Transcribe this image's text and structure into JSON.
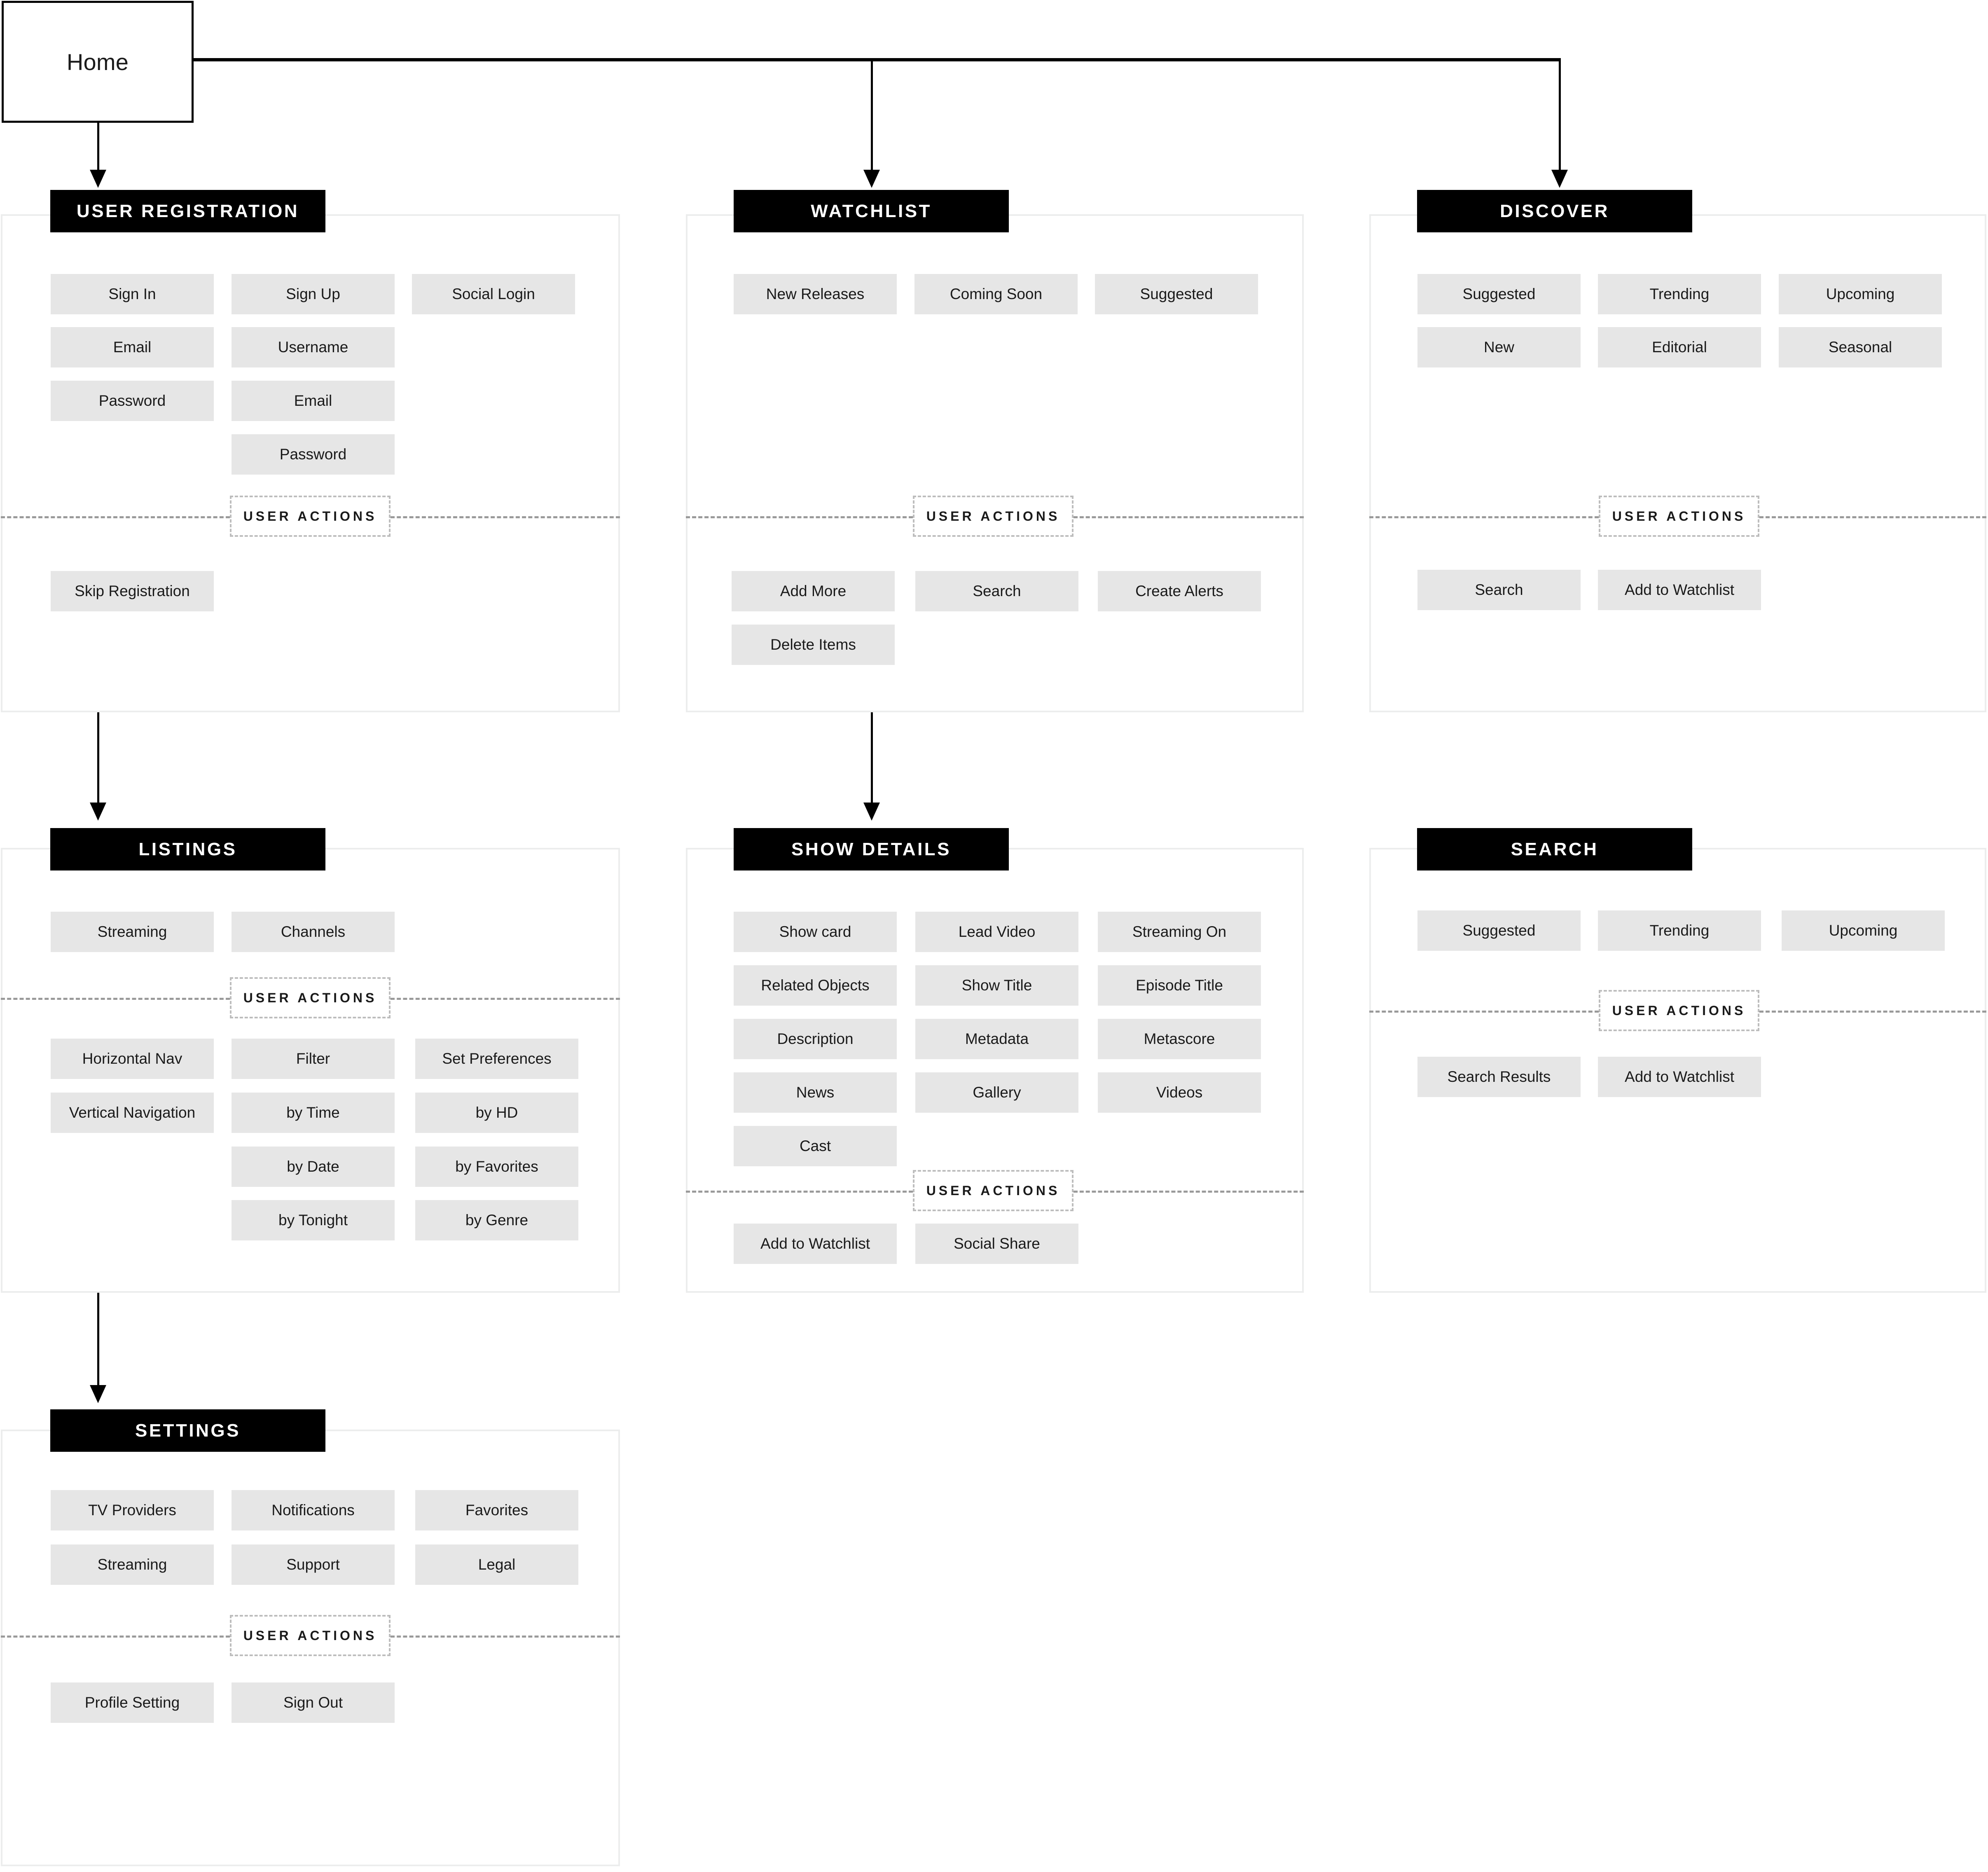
{
  "root": {
    "label": "Home"
  },
  "user_actions_label": "USER ACTIONS",
  "colors": {
    "header_bg": "#000000",
    "header_text": "#ffffff",
    "chip_bg": "#e6e6e6",
    "panel_border": "#eceded",
    "divider": "#9a9a9a",
    "connector": "#000000",
    "text": "#1a1a1a"
  },
  "sections": [
    {
      "id": "user-registration",
      "title": "USER REGISTRATION",
      "primary": [
        "Sign In",
        "Sign Up",
        "Social Login",
        "Email",
        "Username",
        "Password",
        "Email",
        "Password"
      ],
      "actions": [
        "Skip Registration"
      ]
    },
    {
      "id": "watchlist",
      "title": "WATCHLIST",
      "primary": [
        "New Releases",
        "Coming Soon",
        "Suggested"
      ],
      "actions": [
        "Add More",
        "Search",
        "Create Alerts",
        "Delete Items"
      ]
    },
    {
      "id": "discover",
      "title": "DISCOVER",
      "primary": [
        "Suggested",
        "Trending",
        "Upcoming",
        "New",
        "Editorial",
        "Seasonal"
      ],
      "actions": [
        "Search",
        "Add to Watchlist"
      ]
    },
    {
      "id": "listings",
      "title": "LISTINGS",
      "primary": [
        "Streaming",
        "Channels"
      ],
      "actions": [
        "Horizontal Nav",
        "Filter",
        "Set Preferences",
        "Vertical Navigation",
        "by Time",
        "by HD",
        "by Date",
        "by Favorites",
        "by Tonight",
        "by Genre"
      ]
    },
    {
      "id": "show-details",
      "title": "SHOW DETAILS",
      "primary": [
        "Show card",
        "Lead Video",
        "Streaming On",
        "Related Objects",
        "Show Title",
        "Episode Title",
        "Description",
        "Metadata",
        "Metascore",
        "News",
        "Gallery",
        "Videos",
        "Cast"
      ],
      "actions": [
        "Add to Watchlist",
        "Social Share"
      ]
    },
    {
      "id": "search",
      "title": "SEARCH",
      "primary": [
        "Suggested",
        "Trending",
        "Upcoming"
      ],
      "actions": [
        "Search Results",
        "Add to Watchlist"
      ]
    },
    {
      "id": "settings",
      "title": "SETTINGS",
      "primary": [
        "TV Providers",
        "Notifications",
        "Favorites",
        "Streaming",
        "Support",
        "Legal"
      ],
      "actions": [
        "Profile Setting",
        "Sign Out"
      ]
    }
  ]
}
